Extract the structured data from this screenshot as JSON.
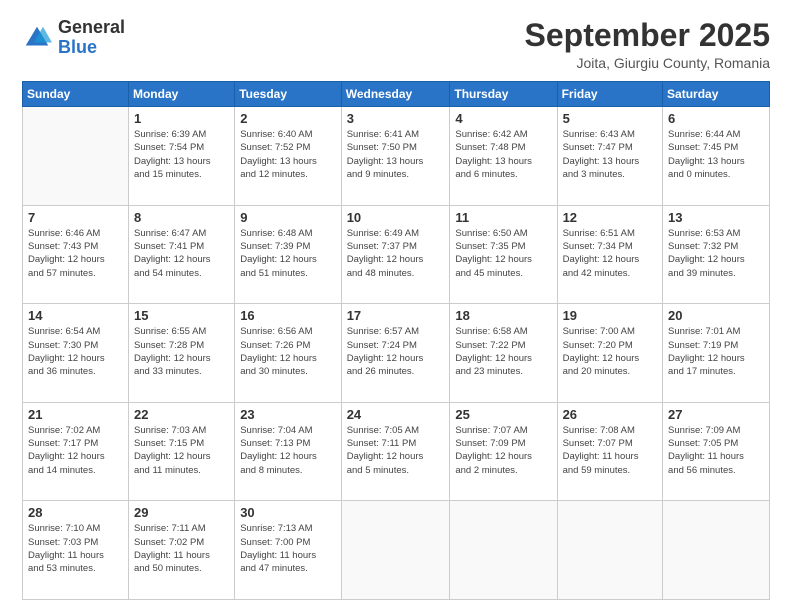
{
  "logo": {
    "general": "General",
    "blue": "Blue"
  },
  "header": {
    "month_year": "September 2025",
    "location": "Joita, Giurgiu County, Romania"
  },
  "days_of_week": [
    "Sunday",
    "Monday",
    "Tuesday",
    "Wednesday",
    "Thursday",
    "Friday",
    "Saturday"
  ],
  "weeks": [
    [
      {
        "day": "",
        "detail": ""
      },
      {
        "day": "1",
        "detail": "Sunrise: 6:39 AM\nSunset: 7:54 PM\nDaylight: 13 hours\nand 15 minutes."
      },
      {
        "day": "2",
        "detail": "Sunrise: 6:40 AM\nSunset: 7:52 PM\nDaylight: 13 hours\nand 12 minutes."
      },
      {
        "day": "3",
        "detail": "Sunrise: 6:41 AM\nSunset: 7:50 PM\nDaylight: 13 hours\nand 9 minutes."
      },
      {
        "day": "4",
        "detail": "Sunrise: 6:42 AM\nSunset: 7:48 PM\nDaylight: 13 hours\nand 6 minutes."
      },
      {
        "day": "5",
        "detail": "Sunrise: 6:43 AM\nSunset: 7:47 PM\nDaylight: 13 hours\nand 3 minutes."
      },
      {
        "day": "6",
        "detail": "Sunrise: 6:44 AM\nSunset: 7:45 PM\nDaylight: 13 hours\nand 0 minutes."
      }
    ],
    [
      {
        "day": "7",
        "detail": "Sunrise: 6:46 AM\nSunset: 7:43 PM\nDaylight: 12 hours\nand 57 minutes."
      },
      {
        "day": "8",
        "detail": "Sunrise: 6:47 AM\nSunset: 7:41 PM\nDaylight: 12 hours\nand 54 minutes."
      },
      {
        "day": "9",
        "detail": "Sunrise: 6:48 AM\nSunset: 7:39 PM\nDaylight: 12 hours\nand 51 minutes."
      },
      {
        "day": "10",
        "detail": "Sunrise: 6:49 AM\nSunset: 7:37 PM\nDaylight: 12 hours\nand 48 minutes."
      },
      {
        "day": "11",
        "detail": "Sunrise: 6:50 AM\nSunset: 7:35 PM\nDaylight: 12 hours\nand 45 minutes."
      },
      {
        "day": "12",
        "detail": "Sunrise: 6:51 AM\nSunset: 7:34 PM\nDaylight: 12 hours\nand 42 minutes."
      },
      {
        "day": "13",
        "detail": "Sunrise: 6:53 AM\nSunset: 7:32 PM\nDaylight: 12 hours\nand 39 minutes."
      }
    ],
    [
      {
        "day": "14",
        "detail": "Sunrise: 6:54 AM\nSunset: 7:30 PM\nDaylight: 12 hours\nand 36 minutes."
      },
      {
        "day": "15",
        "detail": "Sunrise: 6:55 AM\nSunset: 7:28 PM\nDaylight: 12 hours\nand 33 minutes."
      },
      {
        "day": "16",
        "detail": "Sunrise: 6:56 AM\nSunset: 7:26 PM\nDaylight: 12 hours\nand 30 minutes."
      },
      {
        "day": "17",
        "detail": "Sunrise: 6:57 AM\nSunset: 7:24 PM\nDaylight: 12 hours\nand 26 minutes."
      },
      {
        "day": "18",
        "detail": "Sunrise: 6:58 AM\nSunset: 7:22 PM\nDaylight: 12 hours\nand 23 minutes."
      },
      {
        "day": "19",
        "detail": "Sunrise: 7:00 AM\nSunset: 7:20 PM\nDaylight: 12 hours\nand 20 minutes."
      },
      {
        "day": "20",
        "detail": "Sunrise: 7:01 AM\nSunset: 7:19 PM\nDaylight: 12 hours\nand 17 minutes."
      }
    ],
    [
      {
        "day": "21",
        "detail": "Sunrise: 7:02 AM\nSunset: 7:17 PM\nDaylight: 12 hours\nand 14 minutes."
      },
      {
        "day": "22",
        "detail": "Sunrise: 7:03 AM\nSunset: 7:15 PM\nDaylight: 12 hours\nand 11 minutes."
      },
      {
        "day": "23",
        "detail": "Sunrise: 7:04 AM\nSunset: 7:13 PM\nDaylight: 12 hours\nand 8 minutes."
      },
      {
        "day": "24",
        "detail": "Sunrise: 7:05 AM\nSunset: 7:11 PM\nDaylight: 12 hours\nand 5 minutes."
      },
      {
        "day": "25",
        "detail": "Sunrise: 7:07 AM\nSunset: 7:09 PM\nDaylight: 12 hours\nand 2 minutes."
      },
      {
        "day": "26",
        "detail": "Sunrise: 7:08 AM\nSunset: 7:07 PM\nDaylight: 11 hours\nand 59 minutes."
      },
      {
        "day": "27",
        "detail": "Sunrise: 7:09 AM\nSunset: 7:05 PM\nDaylight: 11 hours\nand 56 minutes."
      }
    ],
    [
      {
        "day": "28",
        "detail": "Sunrise: 7:10 AM\nSunset: 7:03 PM\nDaylight: 11 hours\nand 53 minutes."
      },
      {
        "day": "29",
        "detail": "Sunrise: 7:11 AM\nSunset: 7:02 PM\nDaylight: 11 hours\nand 50 minutes."
      },
      {
        "day": "30",
        "detail": "Sunrise: 7:13 AM\nSunset: 7:00 PM\nDaylight: 11 hours\nand 47 minutes."
      },
      {
        "day": "",
        "detail": ""
      },
      {
        "day": "",
        "detail": ""
      },
      {
        "day": "",
        "detail": ""
      },
      {
        "day": "",
        "detail": ""
      }
    ]
  ]
}
